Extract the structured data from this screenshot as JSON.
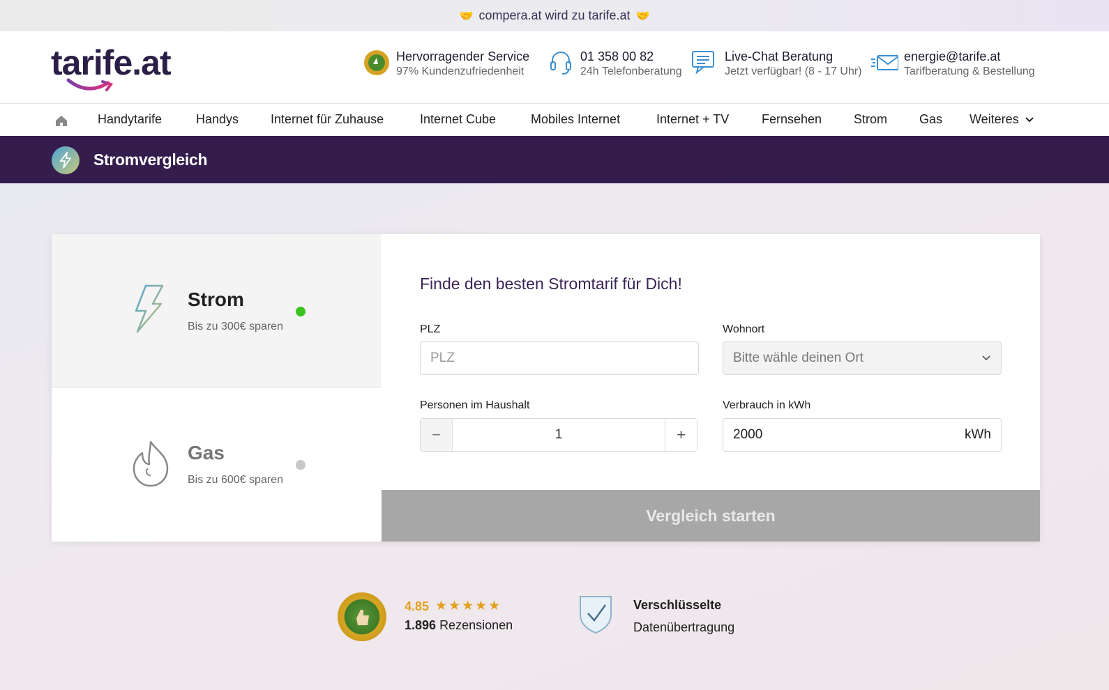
{
  "banner": {
    "text": "compera.at wird zu tarife.at"
  },
  "logo": {
    "text": "tarife.at"
  },
  "header": {
    "service": {
      "title": "Hervorragender Service",
      "subtitle": "97% Kundenzufriedenheit"
    },
    "phone": {
      "title": "01 358 00 82",
      "subtitle": "24h Telefonberatung"
    },
    "chat": {
      "title": "Live-Chat Beratung",
      "subtitle": "Jetzt verfügbar! (8 - 17 Uhr)"
    },
    "mail": {
      "title": "energie@tarife.at",
      "subtitle": "Tarifberatung & Bestellung"
    }
  },
  "nav": {
    "items": [
      "Handytarife",
      "Handys",
      "Internet für Zuhause",
      "Internet Cube",
      "Mobiles Internet",
      "Internet + TV",
      "Fernsehen",
      "Strom",
      "Gas",
      "Weiteres"
    ]
  },
  "section": {
    "title": "Stromvergleich"
  },
  "tabs": [
    {
      "name": "Strom",
      "subtitle": "Bis zu 300€ sparen",
      "status_color": "#3bc41f"
    },
    {
      "name": "Gas",
      "subtitle": "Bis zu 600€ sparen",
      "status_color": "#c8c8c8"
    }
  ],
  "form": {
    "heading": "Finde den besten Stromtarif für Dich!",
    "plz": {
      "label": "PLZ",
      "placeholder": "PLZ",
      "value": ""
    },
    "wohnort": {
      "label": "Wohnort",
      "placeholder": "Bitte wähle deinen Ort"
    },
    "personen": {
      "label": "Personen im Haushalt",
      "value": "1",
      "minus": "−",
      "plus": "+"
    },
    "verbrauch": {
      "label": "Verbrauch in kWh",
      "value": "2000",
      "unit": "kWh"
    },
    "submit": "Vergleich starten"
  },
  "trust": {
    "rating": "4.85",
    "stars": "★★★★★",
    "reviews_count": "1.896",
    "reviews_label": "Rezensionen",
    "security_title": "Verschlüsselte",
    "security_sub": "Datenübertragung"
  },
  "colors": {
    "brand_purple": "#341d4d",
    "accent_orange": "#e3a01f",
    "cta_disabled": "#a7a7a7"
  }
}
